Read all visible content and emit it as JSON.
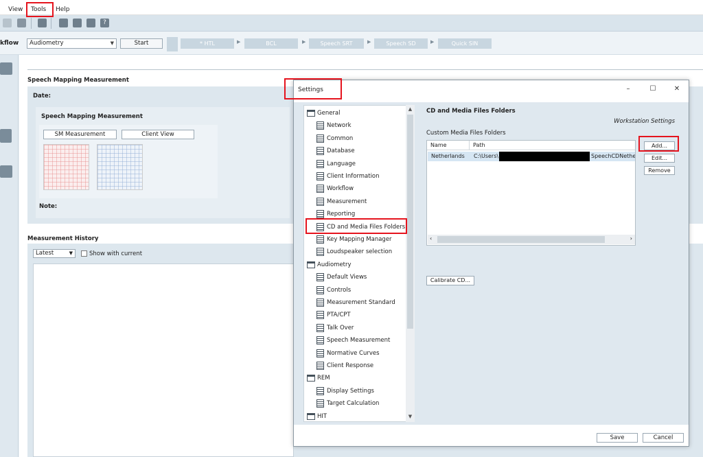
{
  "menu": {
    "view": "View",
    "tools": "Tools",
    "help": "Help"
  },
  "workflow": {
    "label": "kflow",
    "select_value": "Audiometry",
    "start": "Start",
    "steps": [
      "HTL",
      "BCL",
      "Speech SRT",
      "Speech SD",
      "Quick SIN"
    ]
  },
  "main": {
    "sm_title": "Speech Mapping Measurement",
    "date_label": "Date:",
    "card_title": "Speech Mapping Measurement",
    "btn_sm": "SM Measurement",
    "btn_client": "Client View",
    "note_label": "Note:",
    "history_title": "Measurement History",
    "history_select": "Latest",
    "show_current": "Show with current"
  },
  "dialog": {
    "title": "Settings",
    "content_title": "CD and Media Files Folders",
    "workstation": "Workstation Settings",
    "custom_label": "Custom Media Files Folders",
    "columns": [
      "Name",
      "Path"
    ],
    "rows": [
      {
        "name": "Netherlands",
        "path_start": "C:\\Users\\",
        "path_end": "SpeechCDNethe"
      }
    ],
    "btn_add": "Add...",
    "btn_edit": "Edit...",
    "btn_remove": "Remove",
    "btn_calibrate": "Calibrate CD...",
    "btn_save": "Save",
    "btn_cancel": "Cancel",
    "tree": [
      {
        "label": "General",
        "type": "folder"
      },
      {
        "label": "Network",
        "type": "page"
      },
      {
        "label": "Common",
        "type": "page"
      },
      {
        "label": "Database",
        "type": "page"
      },
      {
        "label": "Language",
        "type": "page"
      },
      {
        "label": "Client Information",
        "type": "page"
      },
      {
        "label": "Workflow",
        "type": "page"
      },
      {
        "label": "Measurement",
        "type": "page"
      },
      {
        "label": "Reporting",
        "type": "page"
      },
      {
        "label": "CD and Media Files Folders",
        "type": "page"
      },
      {
        "label": "Key Mapping Manager",
        "type": "page"
      },
      {
        "label": "Loudspeaker selection",
        "type": "page"
      },
      {
        "label": "Audiometry",
        "type": "folder"
      },
      {
        "label": "Default Views",
        "type": "page"
      },
      {
        "label": "Controls",
        "type": "page"
      },
      {
        "label": "Measurement Standard",
        "type": "page"
      },
      {
        "label": "PTA/CPT",
        "type": "page"
      },
      {
        "label": "Talk Over",
        "type": "page"
      },
      {
        "label": "Speech Measurement",
        "type": "page"
      },
      {
        "label": "Normative Curves",
        "type": "page"
      },
      {
        "label": "Client Response",
        "type": "page"
      },
      {
        "label": "REM",
        "type": "folder"
      },
      {
        "label": "Display Settings",
        "type": "page"
      },
      {
        "label": "Target Calculation",
        "type": "page"
      },
      {
        "label": "HIT",
        "type": "folder"
      }
    ]
  },
  "colors": {
    "highlight": "#e5131d",
    "accent": "#d6e6f3"
  }
}
